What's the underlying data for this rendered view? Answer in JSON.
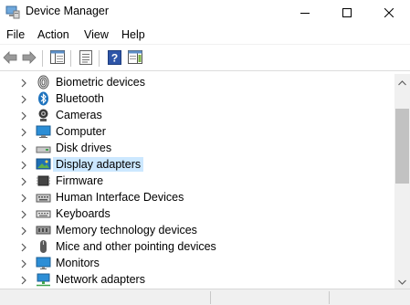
{
  "window": {
    "title": "Device Manager",
    "app_icon": "device-manager-icon",
    "controls": [
      "minimize-icon",
      "maximize-icon",
      "close-icon"
    ]
  },
  "menu": {
    "file": "File",
    "action": "Action",
    "view": "View",
    "help": "Help"
  },
  "toolbar": {
    "buttons": [
      "back-arrow-icon",
      "forward-arrow-icon",
      "show-hide-console-tree-icon",
      "properties-icon",
      "help-icon",
      "show-hide-action-pane-icon"
    ]
  },
  "devices": [
    {
      "label": "Biometric devices",
      "icon": "fingerprint-icon",
      "selected": false
    },
    {
      "label": "Bluetooth",
      "icon": "bluetooth-icon",
      "selected": false
    },
    {
      "label": "Cameras",
      "icon": "camera-icon",
      "selected": false
    },
    {
      "label": "Computer",
      "icon": "computer-icon",
      "selected": false
    },
    {
      "label": "Disk drives",
      "icon": "disk-drive-icon",
      "selected": false
    },
    {
      "label": "Display adapters",
      "icon": "display-adapter-icon",
      "selected": true
    },
    {
      "label": "Firmware",
      "icon": "firmware-icon",
      "selected": false
    },
    {
      "label": "Human Interface Devices",
      "icon": "hid-icon",
      "selected": false
    },
    {
      "label": "Keyboards",
      "icon": "keyboard-icon",
      "selected": false
    },
    {
      "label": "Memory technology devices",
      "icon": "memory-icon",
      "selected": false
    },
    {
      "label": "Mice and other pointing devices",
      "icon": "mouse-icon",
      "selected": false
    },
    {
      "label": "Monitors",
      "icon": "monitor-icon",
      "selected": false
    },
    {
      "label": "Network adapters",
      "icon": "network-adapter-icon",
      "selected": false
    }
  ],
  "colors": {
    "selection": "#cce8ff",
    "accent_blue": "#1e73be"
  }
}
